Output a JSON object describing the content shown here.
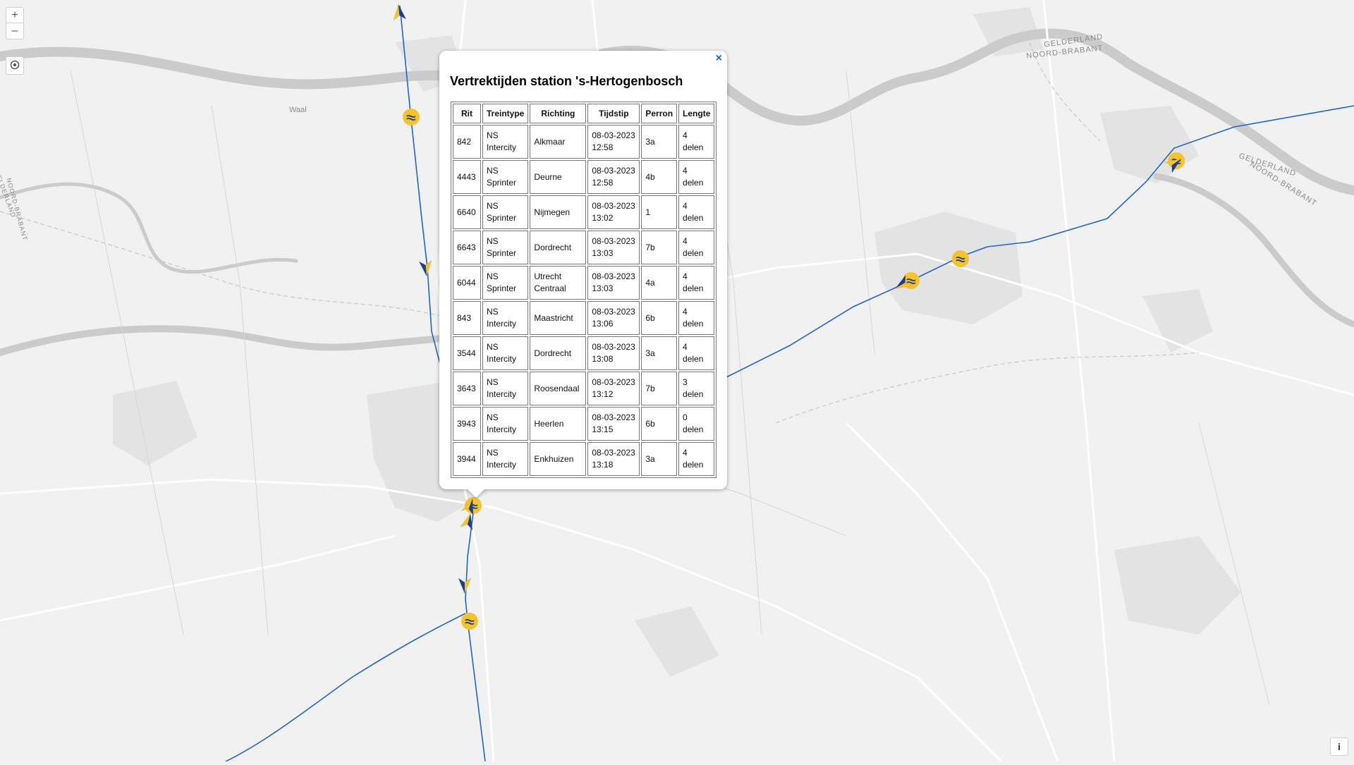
{
  "popup": {
    "close_label": "×",
    "title": "Vertrektijden station 's-Hertogenbosch",
    "columns": [
      "Rit",
      "Treintype",
      "Richting",
      "Tijdstip",
      "Perron",
      "Lengte"
    ],
    "rows": [
      {
        "rit": "842",
        "type": "NS Intercity",
        "dir": "Alkmaar",
        "time": "08-03-2023 12:58",
        "perron": "3a",
        "len": "4 delen"
      },
      {
        "rit": "4443",
        "type": "NS Sprinter",
        "dir": "Deurne",
        "time": "08-03-2023 12:58",
        "perron": "4b",
        "len": "4 delen"
      },
      {
        "rit": "6640",
        "type": "NS Sprinter",
        "dir": "Nijmegen",
        "time": "08-03-2023 13:02",
        "perron": "1",
        "len": "4 delen"
      },
      {
        "rit": "6643",
        "type": "NS Sprinter",
        "dir": "Dordrecht",
        "time": "08-03-2023 13:03",
        "perron": "7b",
        "len": "4 delen"
      },
      {
        "rit": "6044",
        "type": "NS Sprinter",
        "dir": "Utrecht Centraal",
        "time": "08-03-2023 13:03",
        "perron": "4a",
        "len": "4 delen"
      },
      {
        "rit": "843",
        "type": "NS Intercity",
        "dir": "Maastricht",
        "time": "08-03-2023 13:06",
        "perron": "6b",
        "len": "4 delen"
      },
      {
        "rit": "3544",
        "type": "NS Intercity",
        "dir": "Dordrecht",
        "time": "08-03-2023 13:08",
        "perron": "3a",
        "len": "4 delen"
      },
      {
        "rit": "3643",
        "type": "NS Intercity",
        "dir": "Roosendaal",
        "time": "08-03-2023 13:12",
        "perron": "7b",
        "len": "3 delen"
      },
      {
        "rit": "3943",
        "type": "NS Intercity",
        "dir": "Heerlen",
        "time": "08-03-2023 13:15",
        "perron": "6b",
        "len": "0 delen"
      },
      {
        "rit": "3944",
        "type": "NS Intercity",
        "dir": "Enkhuizen",
        "time": "08-03-2023 13:18",
        "perron": "3a",
        "len": "4 delen"
      }
    ]
  },
  "controls": {
    "zoom_in": "+",
    "zoom_out": "–",
    "layers_icon": "layers-icon",
    "info": "i"
  },
  "map_labels": {
    "river": "Waal",
    "border_nw": "GELDERLAND",
    "border_nw2": "NOORD-BRABANT",
    "border_e": "GELDERLAND",
    "border_e2": "NOORD-BRABANT",
    "border_w": "GELDERLAND",
    "border_w2": "NOORD-BRABANT"
  },
  "colors": {
    "route": "#1f66c8",
    "station_marker": "#f7c22c",
    "train_arrow": "#1b3f8f",
    "river": "#c9c9c9"
  }
}
